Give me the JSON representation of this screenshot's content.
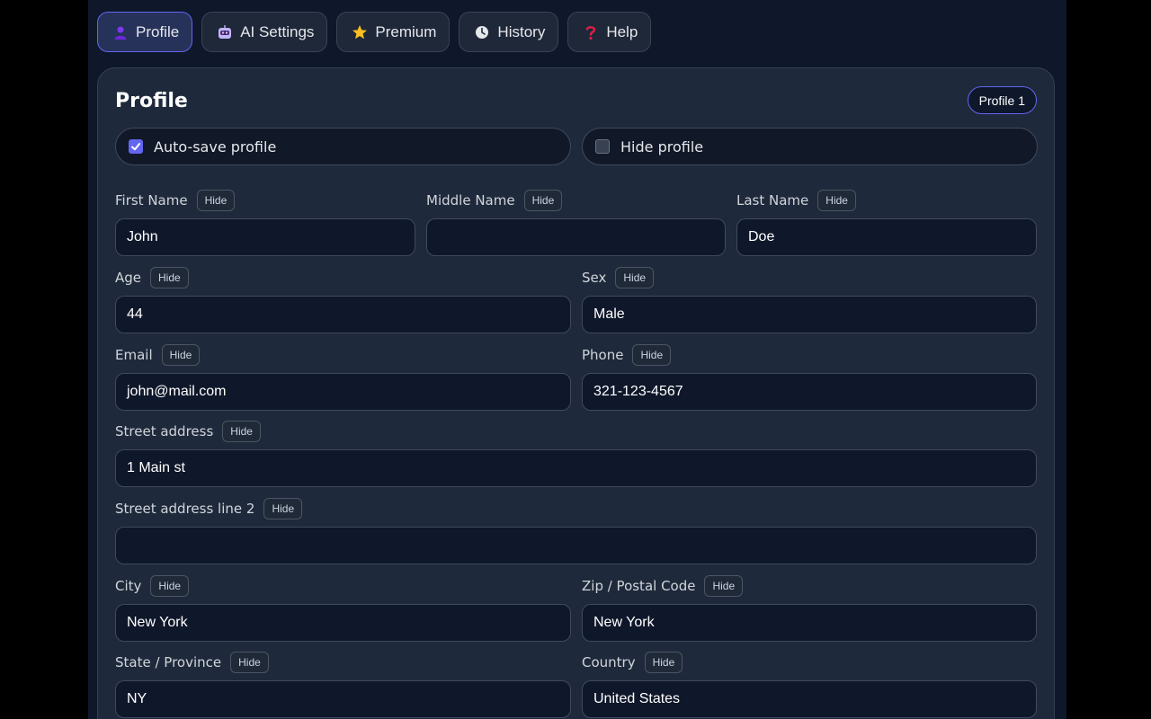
{
  "tabs": [
    {
      "label": "Profile",
      "icon": "person-icon",
      "active": true
    },
    {
      "label": "AI Settings",
      "icon": "robot-icon"
    },
    {
      "label": "Premium",
      "icon": "star-icon"
    },
    {
      "label": "History",
      "icon": "clock-icon"
    },
    {
      "label": "Help",
      "icon": "question-icon"
    }
  ],
  "card": {
    "title": "Profile",
    "badge": "Profile 1",
    "autosave_label": "Auto-save profile",
    "autosave_checked": true,
    "hide_profile_label": "Hide profile",
    "hide_profile_checked": false
  },
  "hide_label": "Hide",
  "fields": {
    "first_name": {
      "label": "First Name",
      "value": "John"
    },
    "middle_name": {
      "label": "Middle Name",
      "value": ""
    },
    "last_name": {
      "label": "Last Name",
      "value": "Doe"
    },
    "age": {
      "label": "Age",
      "value": "44"
    },
    "sex": {
      "label": "Sex",
      "value": "Male"
    },
    "email": {
      "label": "Email",
      "value": "john@mail.com"
    },
    "phone": {
      "label": "Phone",
      "value": "321-123-4567"
    },
    "street": {
      "label": "Street address",
      "value": "1 Main st"
    },
    "street2": {
      "label": "Street address line 2",
      "value": ""
    },
    "city": {
      "label": "City",
      "value": "New York"
    },
    "zip": {
      "label": "Zip / Postal Code",
      "value": "New York"
    },
    "state": {
      "label": "State / Province",
      "value": "NY"
    },
    "country": {
      "label": "Country",
      "value": "United States"
    }
  },
  "colors": {
    "accent": "#6366f1",
    "background": "#0f172a",
    "card": "#1e293b"
  }
}
